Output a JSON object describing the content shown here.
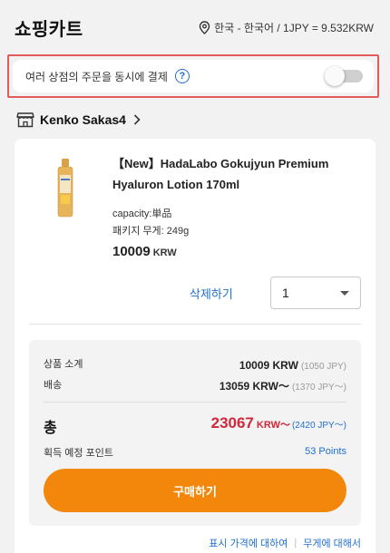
{
  "header": {
    "title": "쇼핑카트",
    "locale": "한국 - 한국어 / 1JPY = 9.532KRW"
  },
  "simultaneous": {
    "label": "여러 상점의 주문을 동시에 결제",
    "help": "?",
    "enabled": false
  },
  "shop": {
    "name": "Kenko Sakas4"
  },
  "item": {
    "title": "【New】HadaLabo Gokujyun Premium Hyaluron Lotion 170ml",
    "option1": "capacity:単品",
    "option2": "패키지 무게: 249g",
    "price": "10009",
    "currency": "KRW",
    "delete_label": "삭제하기",
    "quantity": "1"
  },
  "summary": {
    "subtotal_label": "상품 소계",
    "subtotal_value": "10009 KRW",
    "subtotal_jpy": "(1050 JPY)",
    "shipping_label": "배송",
    "shipping_value": "13059 KRW～",
    "shipping_jpy": "(1370 JPY～)",
    "total_label": "총",
    "total_value": "23067",
    "total_currency": "KRW～",
    "total_jpy": "(2420 JPY～)",
    "points_label": "획득 예정 포인트",
    "points_value": "53 Points",
    "buy_label": "구매하기"
  },
  "footer": {
    "price_info": "표시 가격에 대하여",
    "weight_info": "무게에 대해서"
  },
  "colors": {
    "accent_orange": "#f2870c",
    "link_blue": "#1f6fd1",
    "total_red": "#d0283a",
    "highlight_border": "#e35a5a"
  }
}
